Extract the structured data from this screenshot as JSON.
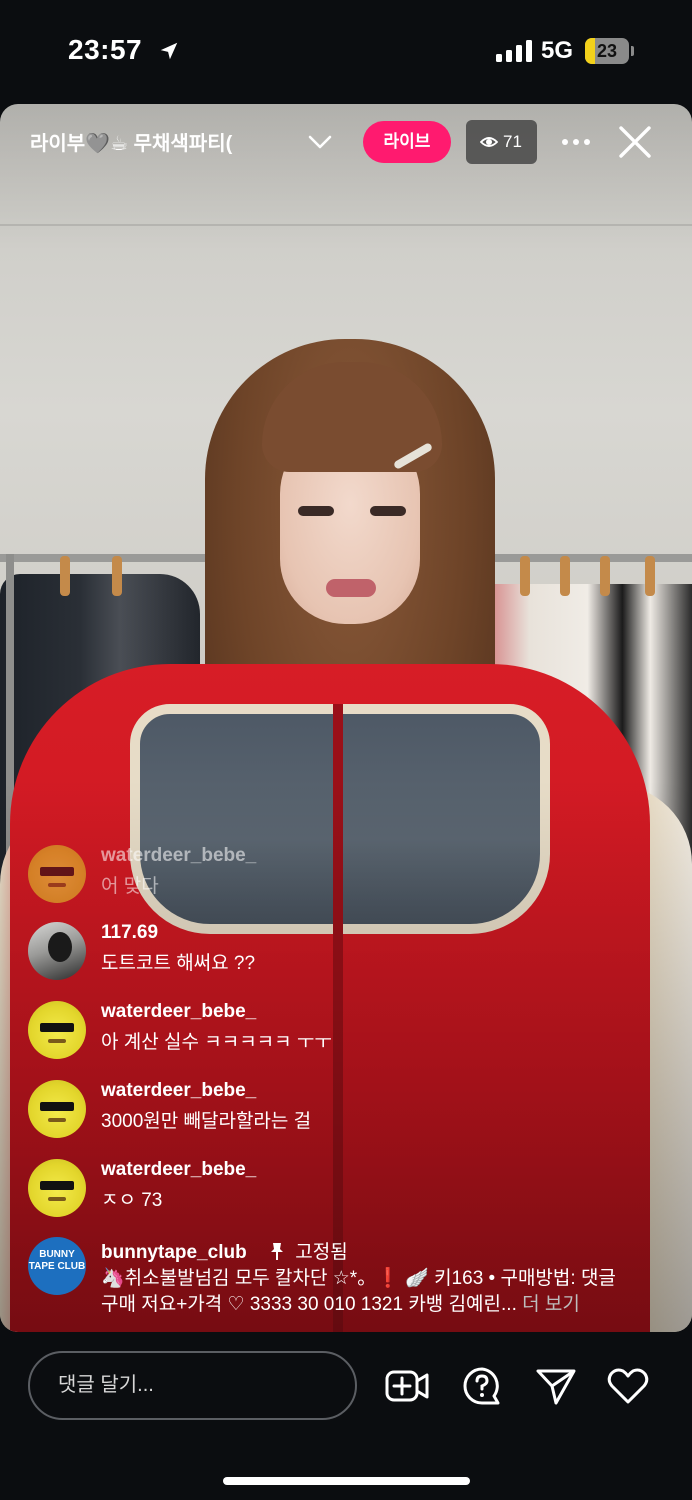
{
  "status_bar": {
    "time": "23:57",
    "network": "5G",
    "battery": "23",
    "battery_level": 0.23
  },
  "live": {
    "host_title": "라이부🩶☕ 무채색파티(",
    "live_label": "라이브",
    "viewer_count": "71"
  },
  "comments": [
    {
      "user": "waterdeer_bebe_",
      "text": "어 맞다",
      "avatar": "spongebob-sunglasses",
      "faded": true
    },
    {
      "user": "117.69",
      "text": "도트코트 해써요 ??",
      "avatar": "photo"
    },
    {
      "user": "waterdeer_bebe_",
      "text": "아 계산 실수 ㅋㅋㅋㅋㅋ ㅜㅜ",
      "avatar": "spongebob-sunglasses"
    },
    {
      "user": "waterdeer_bebe_",
      "text": "3000원만 빼달라할라는 걸",
      "avatar": "spongebob-sunglasses"
    },
    {
      "user": "waterdeer_bebe_",
      "text": "ㅈㅇ 73",
      "avatar": "spongebob-sunglasses"
    }
  ],
  "pinned": {
    "user": "bunnytape_club",
    "pinned_label": "고정됨",
    "line1": "🦄취소불발넘김 모두 칼차단 ☆*。❗️ 🪽 키163 • 구매방법: 댓글",
    "line2": "구매 저요+가격 ♡ 3333 30 010 1321 카뱅 김예린...",
    "more": "더 보기",
    "avatar_text": "BUNNY TAPE CLUB"
  },
  "bottom_bar": {
    "comment_placeholder": "댓글 달기..."
  },
  "icons": {
    "location": "location-arrow-icon",
    "signal": "cellular-signal-icon",
    "chevron": "chevron-down-icon",
    "eye": "eye-icon",
    "more": "more-horizontal-icon",
    "close": "close-icon",
    "pin": "pin-icon",
    "add_guest": "add-video-icon",
    "question": "question-icon",
    "share": "send-icon",
    "like": "heart-icon"
  },
  "colors": {
    "live_badge": "#ff1a6f",
    "battery": "#f3d11b",
    "background": "#0b0d10"
  }
}
